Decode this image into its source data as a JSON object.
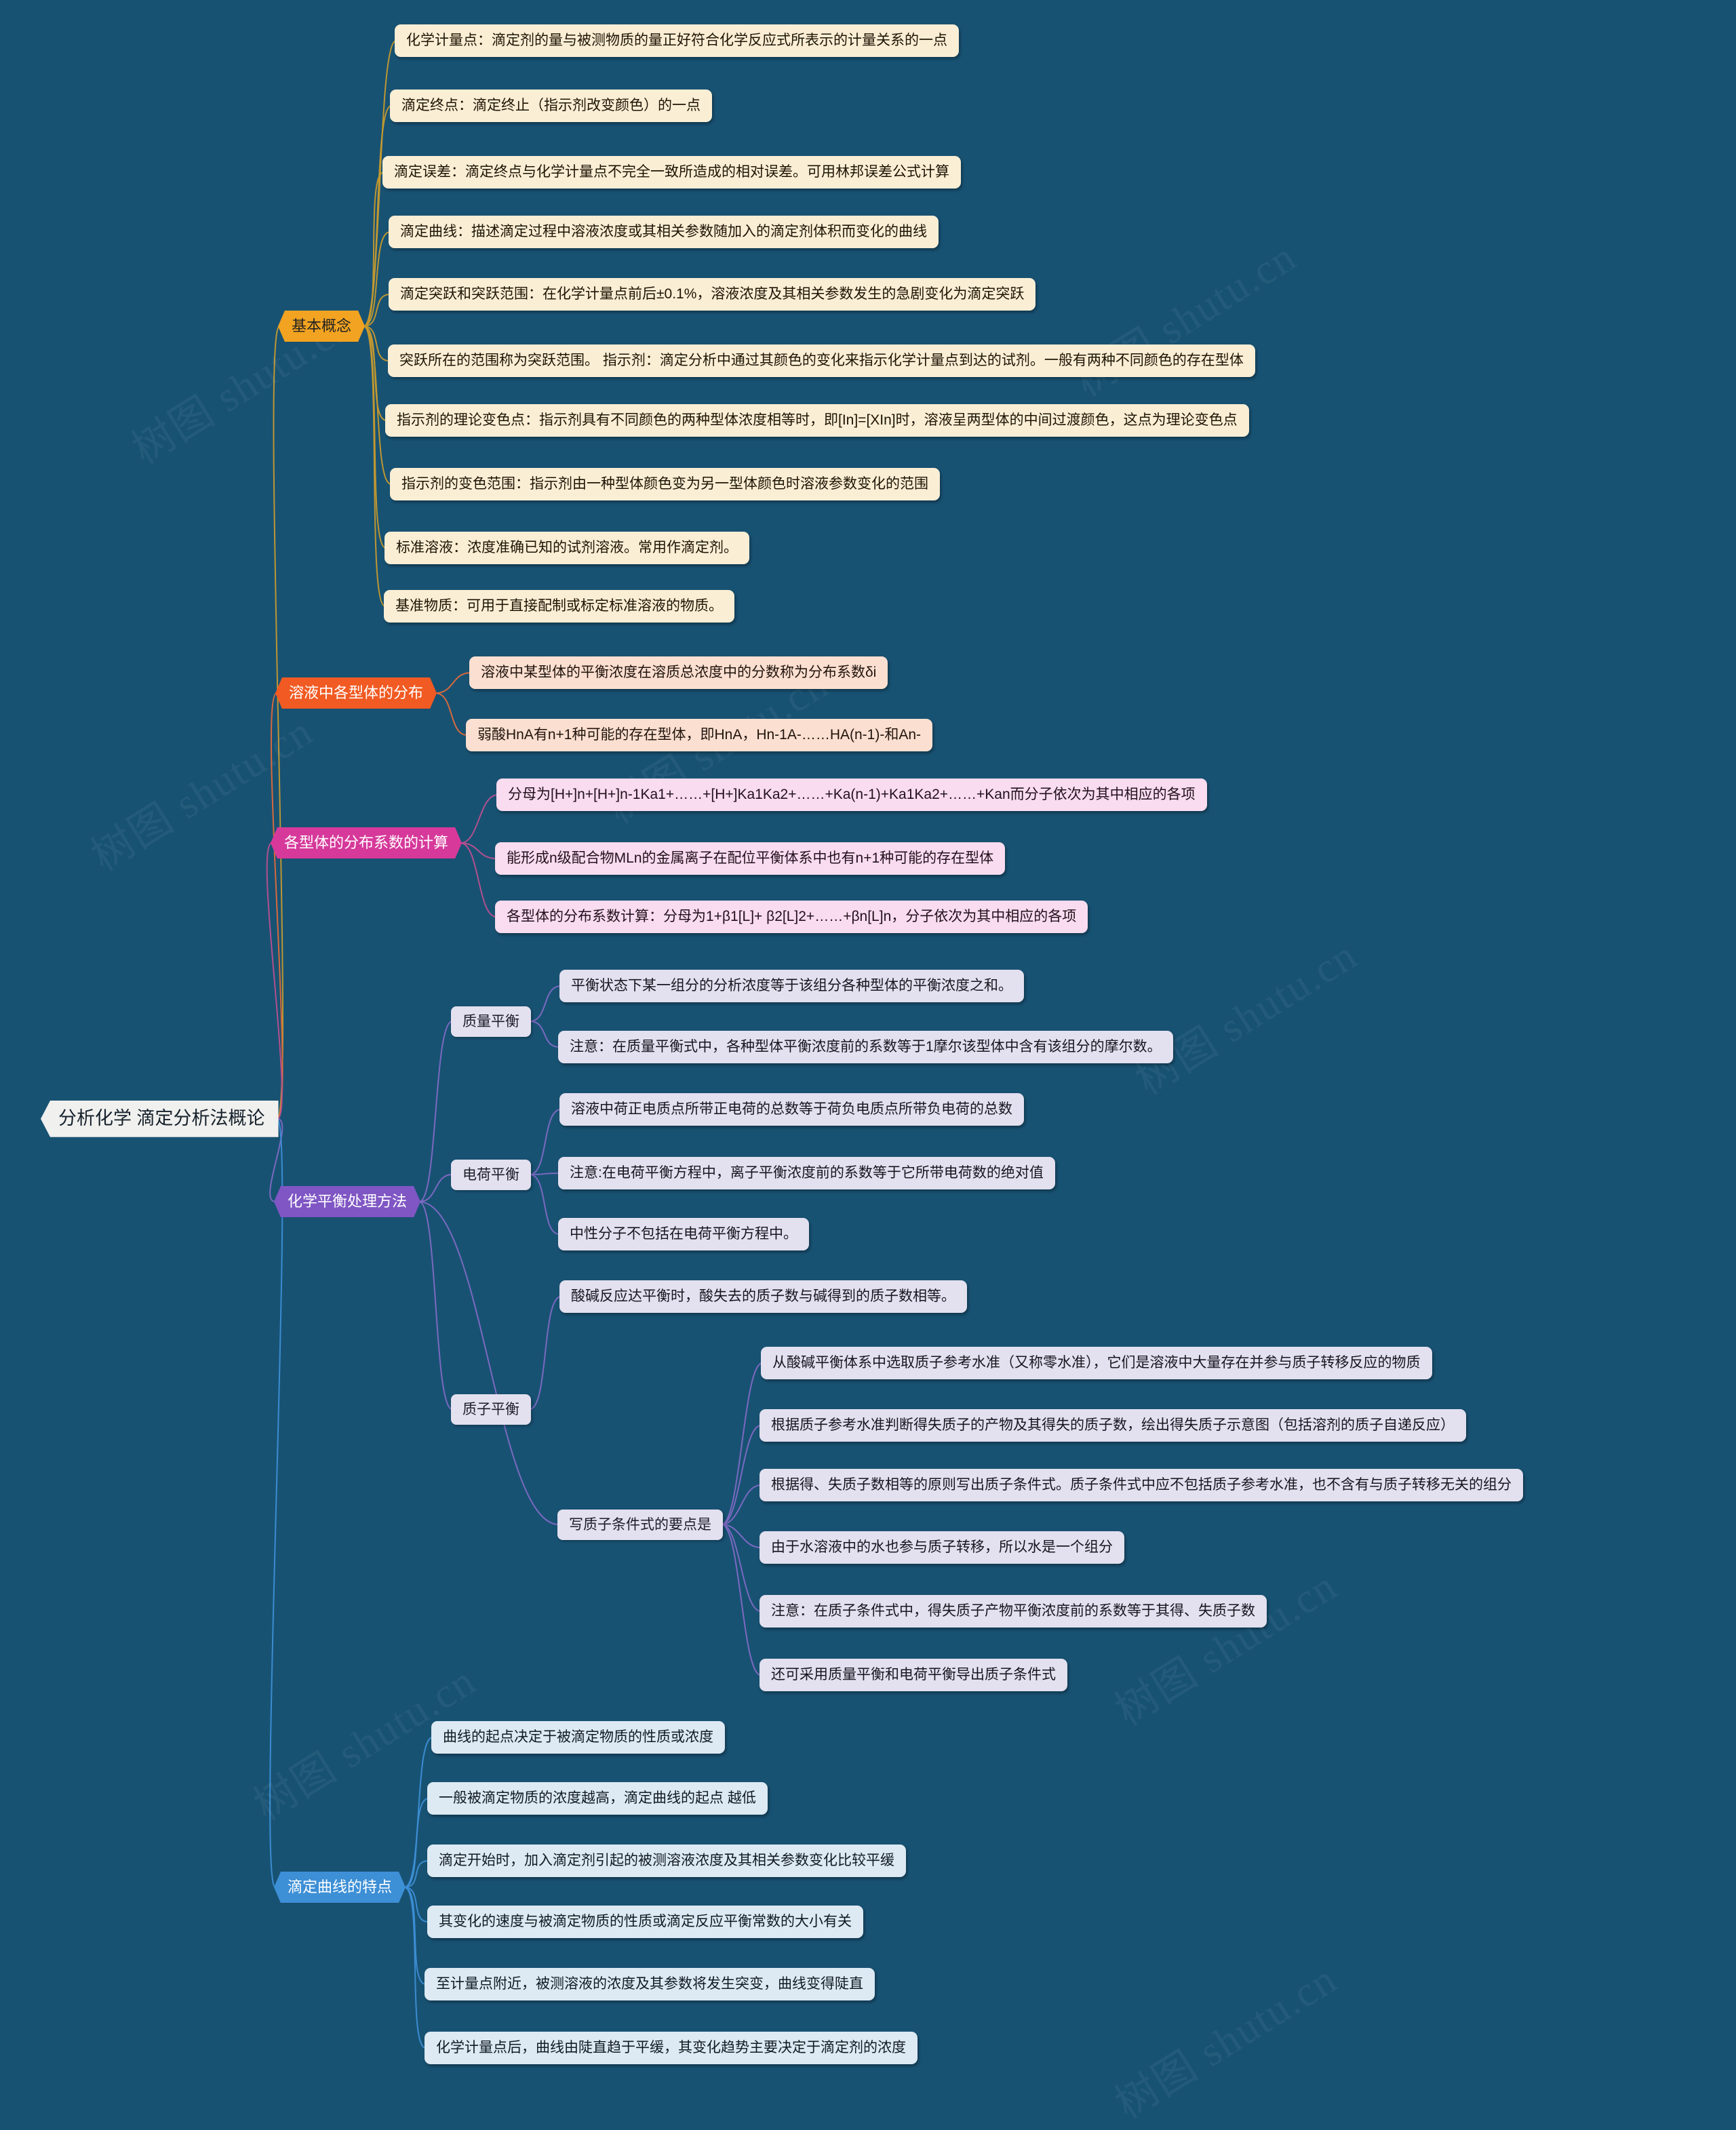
{
  "title": "分析化学 滴定分析法概论",
  "colors": {
    "background": "#185273",
    "amber": "#f2a321",
    "orange": "#f15a22",
    "magenta": "#d6399a",
    "purple": "#7f56c4",
    "blue": "#3d8fd6"
  },
  "watermarks": [
    "树图 shutu.cn",
    "树图 shutu.cn",
    "树图 shutu.cn",
    "树图 shutu.cn",
    "树图 shutu.cn",
    "树图 shutu.cn",
    "树图 shutu.cn",
    "树图 shutu.cn"
  ],
  "branches": [
    {
      "label": "基本概念",
      "color": "amber",
      "leaves": [
        "化学计量点：滴定剂的量与被测物质的量正好符合化学反应式所表示的计量关系的一点",
        "滴定终点：滴定终止（指示剂改变颜色）的一点",
        "滴定误差：滴定终点与化学计量点不完全一致所造成的相对误差。可用林邦误差公式计算",
        "滴定曲线：描述滴定过程中溶液浓度或其相关参数随加入的滴定剂体积而变化的曲线",
        "滴定突跃和突跃范围：在化学计量点前后±0.1%，溶液浓度及其相关参数发生的急剧变化为滴定突跃",
        "突跃所在的范围称为突跃范围。 指示剂：滴定分析中通过其颜色的变化来指示化学计量点到达的试剂。一般有两种不同颜色的存在型体",
        "指示剂的理论变色点：指示剂具有不同颜色的两种型体浓度相等时，即[In]=[XIn]时，溶液呈两型体的中间过渡颜色，这点为理论变色点",
        "指示剂的变色范围：指示剂由一种型体颜色变为另一型体颜色时溶液参数变化的范围",
        "标准溶液：浓度准确已知的试剂溶液。常用作滴定剂。",
        "基准物质：可用于直接配制或标定标准溶液的物质。"
      ]
    },
    {
      "label": "溶液中各型体的分布",
      "color": "orange",
      "leaves": [
        "溶液中某型体的平衡浓度在溶质总浓度中的分数称为分布系数δi",
        "弱酸HnA有n+1种可能的存在型体，即HnA，Hn-1A-……HA(n-1)-和An-"
      ]
    },
    {
      "label": "各型体的分布系数的计算",
      "color": "magenta",
      "leaves": [
        "分母为[H+]n+[H+]n-1Ka1+……+[H+]Ka1Ka2+……+Ka(n-1)+Ka1Ka2+……+Kan而分子依次为其中相应的各项",
        "能形成n级配合物MLn的金属离子在配位平衡体系中也有n+1种可能的存在型体",
        "各型体的分布系数计算：分母为1+β1[L]+ β2[L]2+……+βn[L]n，分子依次为其中相应的各项"
      ]
    },
    {
      "label": "化学平衡处理方法",
      "color": "purple",
      "subs": [
        {
          "label": "质量平衡",
          "leaves": [
            "平衡状态下某一组分的分析浓度等于该组分各种型体的平衡浓度之和。",
            "注意：在质量平衡式中，各种型体平衡浓度前的系数等于1摩尔该型体中含有该组分的摩尔数。"
          ]
        },
        {
          "label": "电荷平衡",
          "leaves": [
            "溶液中荷正电质点所带正电荷的总数等于荷负电质点所带负电荷的总数",
            "注意:在电荷平衡方程中，离子平衡浓度前的系数等于它所带电荷数的绝对值",
            "中性分子不包括在电荷平衡方程中。"
          ]
        },
        {
          "label": "质子平衡",
          "leaves": [
            "酸碱反应达平衡时，酸失去的质子数与碱得到的质子数相等。"
          ]
        },
        {
          "label": "写质子条件式的要点是",
          "leaves": [
            "从酸碱平衡体系中选取质子参考水准（又称零水准），它们是溶液中大量存在并参与质子转移反应的物质",
            "根据质子参考水准判断得失质子的产物及其得失的质子数，绘出得失质子示意图（包括溶剂的质子自递反应）",
            "根据得、失质子数相等的原则写出质子条件式。质子条件式中应不包括质子参考水准，也不含有与质子转移无关的组分",
            "由于水溶液中的水也参与质子转移，所以水是一个组分",
            "注意：在质子条件式中，得失质子产物平衡浓度前的系数等于其得、失质子数",
            "还可采用质量平衡和电荷平衡导出质子条件式"
          ]
        }
      ]
    },
    {
      "label": "滴定曲线的特点",
      "color": "blue",
      "leaves": [
        "曲线的起点决定于被滴定物质的性质或浓度",
        "一般被滴定物质的浓度越高，滴定曲线的起点 越低",
        "滴定开始时，加入滴定剂引起的被测溶液浓度及其相关参数变化比较平缓",
        "其变化的速度与被滴定物质的性质或滴定反应平衡常数的大小有关",
        "至计量点附近，被测溶液的浓度及其参数将发生突变，曲线变得陡直",
        "化学计量点后，曲线由陡直趋于平缓，其变化趋势主要决定于滴定剂的浓度"
      ]
    }
  ]
}
